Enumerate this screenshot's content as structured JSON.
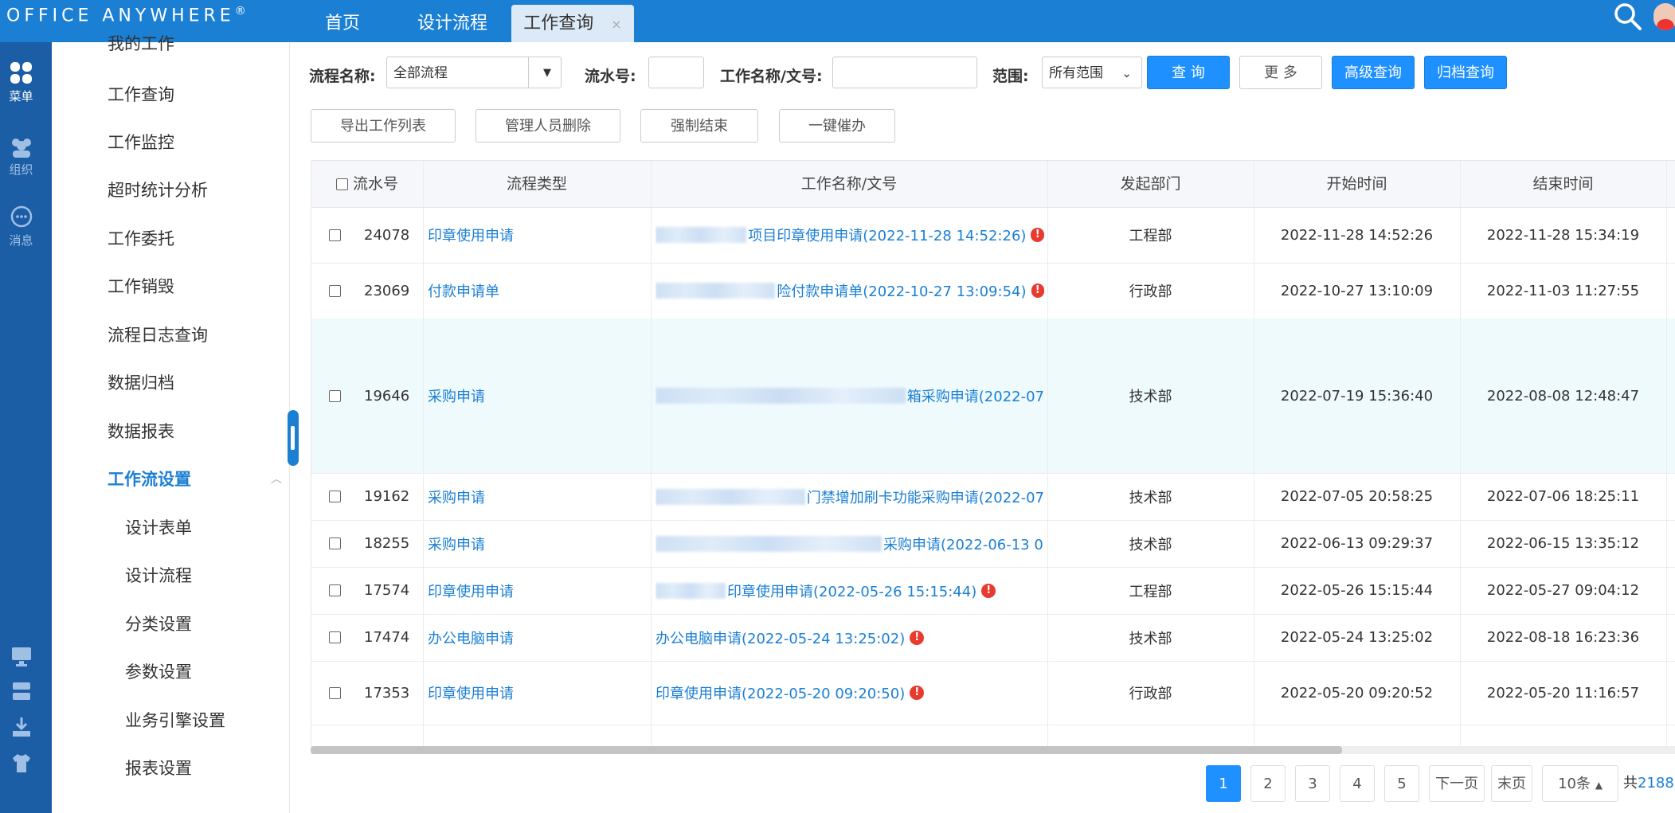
{
  "app": {
    "logo": "OFFICE ANYWHERE",
    "logo_mark": "®"
  },
  "tabs": [
    {
      "label": "首页"
    },
    {
      "label": "设计流程"
    },
    {
      "label": "工作查询",
      "close": "×"
    }
  ],
  "rail": [
    {
      "label": "菜单",
      "icon": "grid-icon"
    },
    {
      "label": "组织",
      "icon": "people-icon"
    },
    {
      "label": "消息",
      "icon": "chat-icon"
    }
  ],
  "menu": {
    "items": [
      "我的工作",
      "工作查询",
      "工作监控",
      "超时统计分析",
      "工作委托",
      "工作销毁",
      "流程日志查询",
      "数据归档",
      "数据报表",
      "工作流设置",
      "设计表单",
      "设计流程",
      "分类设置",
      "参数设置",
      "业务引擎设置",
      "报表设置"
    ]
  },
  "filters": {
    "flow_name_label": "流程名称:",
    "flow_name_value": "全部流程",
    "serial_label": "流水号:",
    "serial_value": "",
    "work_name_label": "工作名称/文号:",
    "work_name_value": "",
    "scope_label": "范围:",
    "scope_value": "所有范围",
    "search_btn": "查 询",
    "more_btn": "更 多",
    "advanced_btn": "高级查询",
    "archive_btn": "归档查询"
  },
  "actions": {
    "export": "导出工作列表",
    "admin_delete": "管理人员删除",
    "force_end": "强制结束",
    "urge": "一键催办"
  },
  "table": {
    "columns": [
      "流水号",
      "流程类型",
      "工作名称/文号",
      "发起部门",
      "开始时间",
      "结束时间"
    ],
    "rows": [
      {
        "id": "24078",
        "type": "印章使用申请",
        "name": "项目印章使用申请(2022-11-28 14:52:26)",
        "dept": "工程部",
        "start": "2022-11-28 14:52:26",
        "end": "2022-11-28 15:34:19"
      },
      {
        "id": "23069",
        "type": "付款申请单",
        "name": "险付款申请单(2022-10-27 13:09:54)",
        "dept": "行政部",
        "start": "2022-10-27 13:10:09",
        "end": "2022-11-03 11:27:55"
      },
      {
        "id": "19646",
        "type": "采购申请",
        "name": "箱采购申请(2022-07",
        "dept": "技术部",
        "start": "2022-07-19 15:36:40",
        "end": "2022-08-08 12:48:47"
      },
      {
        "id": "19162",
        "type": "采购申请",
        "name": "门禁增加刷卡功能采购申请(2022-07",
        "dept": "技术部",
        "start": "2022-07-05 20:58:25",
        "end": "2022-07-06 18:25:11"
      },
      {
        "id": "18255",
        "type": "采购申请",
        "name": "采购申请(2022-06-13 0",
        "dept": "技术部",
        "start": "2022-06-13 09:29:37",
        "end": "2022-06-15 13:35:12"
      },
      {
        "id": "17574",
        "type": "印章使用申请",
        "name": "印章使用申请(2022-05-26 15:15:44)",
        "dept": "工程部",
        "start": "2022-05-26 15:15:44",
        "end": "2022-05-27 09:04:12"
      },
      {
        "id": "17474",
        "type": "办公电脑申请",
        "name": "办公电脑申请(2022-05-24 13:25:02)",
        "dept": "技术部",
        "start": "2022-05-24 13:25:02",
        "end": "2022-08-18 16:23:36"
      },
      {
        "id": "17353",
        "type": "印章使用申请",
        "name": "印章使用申请(2022-05-20 09:20:50)",
        "dept": "行政部",
        "start": "2022-05-20 09:20:52",
        "end": "2022-05-20 11:16:57"
      }
    ]
  },
  "pager": {
    "pages": [
      "1",
      "2",
      "3",
      "4",
      "5"
    ],
    "next": "下一页",
    "last": "末页",
    "page_size": "10条",
    "total_prefix": "共",
    "total_num": "2188"
  }
}
